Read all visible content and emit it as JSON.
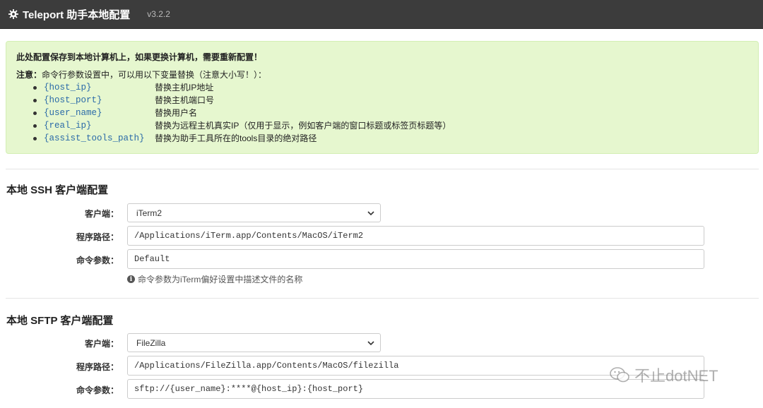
{
  "header": {
    "title": "Teleport 助手本地配置",
    "version": "v3.2.2"
  },
  "notice": {
    "headline": "此处配置保存到本地计算机上，如果更换计算机，需要重新配置！",
    "note_label": "注意：",
    "note_text": "命令行参数设置中，可以用以下变量替换（注意大小写！）：",
    "variables": [
      {
        "name": "{host_ip}",
        "desc": "替换主机IP地址"
      },
      {
        "name": "{host_port}",
        "desc": "替换主机端口号"
      },
      {
        "name": "{user_name}",
        "desc": "替换用户名"
      },
      {
        "name": "{real_ip}",
        "desc": "替换为远程主机真实IP（仅用于显示，例如客户端的窗口标题或标签页标题等）"
      },
      {
        "name": "{assist_tools_path}",
        "desc": "替换为助手工具所在的tools目录的绝对路径"
      }
    ]
  },
  "ssh": {
    "title": "本地 SSH 客户端配置",
    "client_label": "客户端：",
    "client_value": "iTerm2",
    "path_label": "程序路径：",
    "path_value": "/Applications/iTerm.app/Contents/MacOS/iTerm2",
    "args_label": "命令参数：",
    "args_value": "Default",
    "help": "命令参数为iTerm偏好设置中描述文件的名称"
  },
  "sftp": {
    "title": "本地 SFTP 客户端配置",
    "client_label": "客户端：",
    "client_value": "FileZilla",
    "path_label": "程序路径：",
    "path_value": "/Applications/FileZilla.app/Contents/MacOS/filezilla",
    "args_label": "命令参数：",
    "args_value": "sftp://{user_name}:****@{host_ip}:{host_port}"
  },
  "watermark": {
    "text": "不止dotNET"
  }
}
